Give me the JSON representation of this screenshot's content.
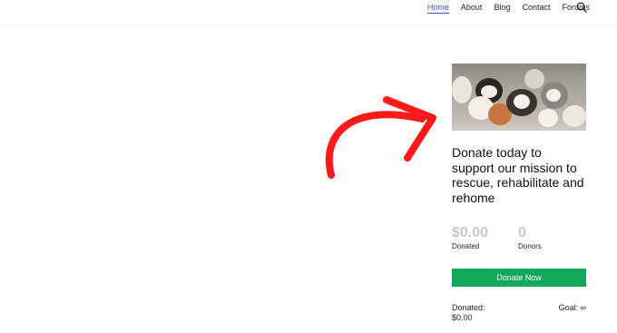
{
  "nav": {
    "items": [
      {
        "label": "Home",
        "active": true
      },
      {
        "label": "About",
        "active": false
      },
      {
        "label": "Blog",
        "active": false
      },
      {
        "label": "Contact",
        "active": false
      },
      {
        "label": "Forums",
        "active": false
      }
    ],
    "search_icon": "search-icon"
  },
  "colors": {
    "nav_active": "#3855d6",
    "arrow": "#ff1a1a",
    "button": "#12a85a",
    "muted_value": "#c8c8c8"
  },
  "widget": {
    "image_subject": "puppies",
    "title": "Donate today to support our mission to rescue, rehabilitate and rehome",
    "stats": {
      "donated_value": "$0.00",
      "donated_label": "Donated",
      "donors_value": "0",
      "donors_label": "Donors"
    },
    "button_label": "Donate Now",
    "summary": {
      "donated_label": "Donated:",
      "donated_amount": "$0.00",
      "goal_label": "Goal: ∞"
    }
  }
}
